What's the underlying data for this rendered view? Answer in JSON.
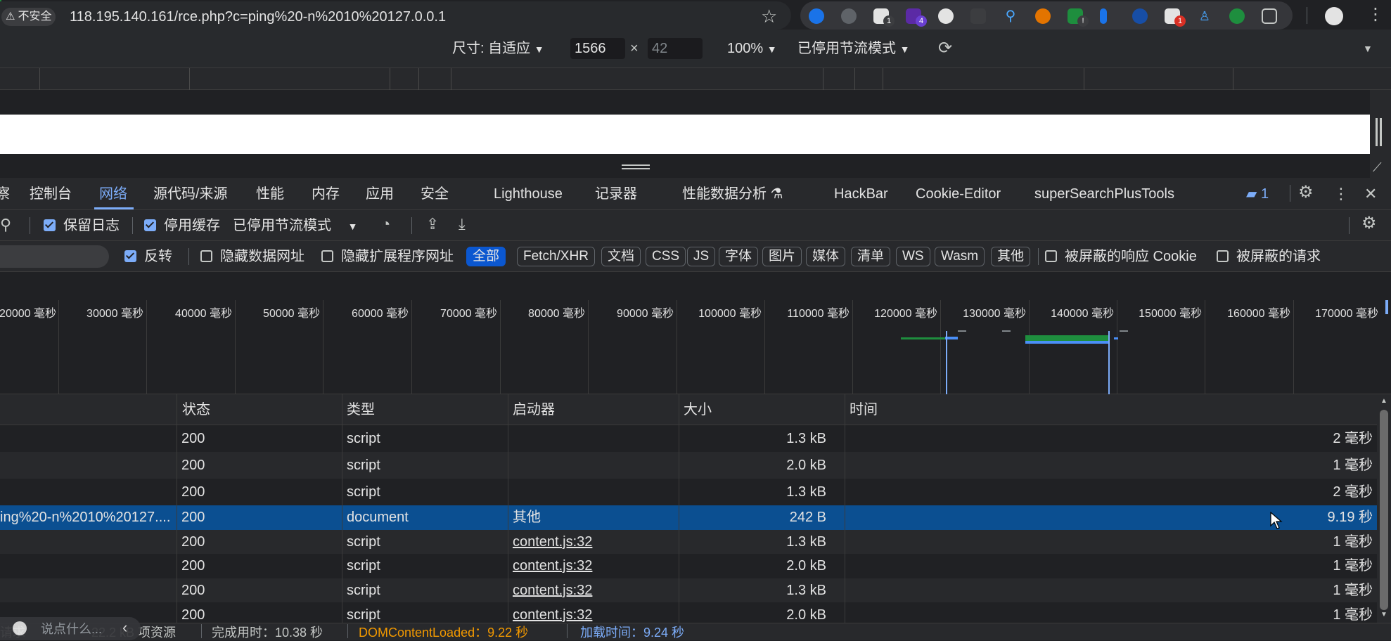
{
  "browser": {
    "insecure_label": "不安全",
    "url": "118.195.140.161/rce.php?c=ping%20-n%2010%20127.0.0.1",
    "extension_badges": [
      "1",
      "4",
      "!",
      "1"
    ]
  },
  "device_toolbar": {
    "dimensions_label": "尺寸: 自适应",
    "width_value": "1566",
    "times": "×",
    "height_value": "42",
    "zoom": "100%",
    "throttle": "已停用节流模式"
  },
  "devtools": {
    "tabs": [
      "察",
      "控制台",
      "网络",
      "源代码/来源",
      "性能",
      "内存",
      "应用",
      "安全",
      "Lighthouse",
      "记录器",
      "性能数据分析 ⚗",
      "HackBar",
      "Cookie-Editor",
      "superSearchPlusTools"
    ],
    "active_tab": "网络",
    "issues_count": "1",
    "toolbar": {
      "preserve_log": "保留日志",
      "disable_cache": "停用缓存",
      "throttle": "已停用节流模式"
    },
    "filters": {
      "invert": "反转",
      "hide_data_urls": "隐藏数据网址",
      "hide_extension_urls": "隐藏扩展程序网址",
      "types": [
        "全部",
        "Fetch/XHR",
        "文档",
        "CSS",
        "JS",
        "字体",
        "图片",
        "媒体",
        "清单",
        "WS",
        "Wasm",
        "其他"
      ],
      "blocked_cookies": "被屏蔽的响应 Cookie",
      "blocked_requests": "被屏蔽的请求"
    },
    "timeline_labels": [
      "20000 毫秒",
      "30000 毫秒",
      "40000 毫秒",
      "50000 毫秒",
      "60000 毫秒",
      "70000 毫秒",
      "80000 毫秒",
      "90000 毫秒",
      "100000 毫秒",
      "110000 毫秒",
      "120000 毫秒",
      "130000 毫秒",
      "140000 毫秒",
      "150000 毫秒",
      "160000 毫秒",
      "170000 毫秒"
    ],
    "table": {
      "headers": [
        "状态",
        "类型",
        "启动器",
        "大小",
        "时间"
      ],
      "rows": [
        {
          "name": "",
          "status": "200",
          "type": "script",
          "initiator": "",
          "size": "1.3 kB",
          "time": "2 毫秒"
        },
        {
          "name": "",
          "status": "200",
          "type": "script",
          "initiator": "",
          "size": "2.0 kB",
          "time": "1 毫秒"
        },
        {
          "name": "",
          "status": "200",
          "type": "script",
          "initiator": "",
          "size": "1.3 kB",
          "time": "2 毫秒"
        },
        {
          "name": "ing%20-n%2010%20127....",
          "status": "200",
          "type": "document",
          "initiator": "其他",
          "size": "242 B",
          "time": "9.19 秒"
        },
        {
          "name": "",
          "status": "200",
          "type": "script",
          "initiator": "content.js:32",
          "size": "1.3 kB",
          "time": "1 毫秒"
        },
        {
          "name": "",
          "status": "200",
          "type": "script",
          "initiator": "content.js:32",
          "size": "2.0 kB",
          "time": "1 毫秒"
        },
        {
          "name": "",
          "status": "200",
          "type": "script",
          "initiator": "content.js:32",
          "size": "1.3 kB",
          "time": "1 毫秒"
        },
        {
          "name": "",
          "status": "200",
          "type": "script",
          "initiator": "content.js:32",
          "size": "2.0 kB",
          "time": "1 毫秒"
        }
      ]
    },
    "status": {
      "requests": "请求",
      "transferred": "22.2 kB 项资源",
      "finish": "完成用时：10.38 秒",
      "dom_loaded": "DOMContentLoaded：9.22 秒",
      "load": "加载时间：9.24 秒"
    },
    "overlay_hint": "说点什么..."
  },
  "colors": {
    "accent": "#7cacf8",
    "selected_row": "#0b4f91",
    "dom_loaded": "#f29900",
    "load": "#7cacf8"
  }
}
